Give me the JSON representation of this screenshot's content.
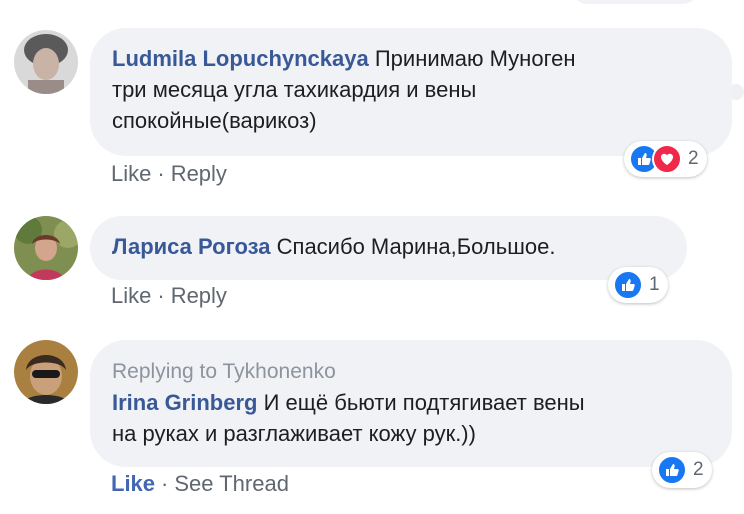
{
  "comments": [
    {
      "author": "Ludmila Lopuchynckaya",
      "text_line1": "Принимаю Муноген",
      "text_line2": "три месяца угла тахикардия и вены",
      "text_line3": "спокойные(варикоз)",
      "reactions": {
        "icons": [
          "like-icon",
          "love-icon"
        ],
        "count": "2"
      },
      "actions": {
        "like": "Like",
        "sep": "·",
        "reply": "Reply"
      }
    },
    {
      "author": "Лариса Рогоза",
      "text_line1": "Спасибо Марина,Большое.",
      "reactions": {
        "icons": [
          "like-icon"
        ],
        "count": "1"
      },
      "actions": {
        "like": "Like",
        "sep": "·",
        "reply": "Reply"
      }
    },
    {
      "replying_to": "Replying to Tykhonenko",
      "author": "Irina Grinberg",
      "text_line1": "И ещё бьюти подтягивает вены",
      "text_line2": "на руках и разглаживает кожу рук.))",
      "reactions": {
        "icons": [
          "like-icon"
        ],
        "count": "2"
      },
      "actions": {
        "like": "Like",
        "like_active": true,
        "sep": "·",
        "see_thread": "See Thread"
      }
    }
  ],
  "colors": {
    "author": "#385898",
    "bubble": "#f0f2f5",
    "like_blue": "#1877f2",
    "love_red": "#f02849",
    "action_gray": "#606770",
    "action_active": "#4267b2"
  }
}
